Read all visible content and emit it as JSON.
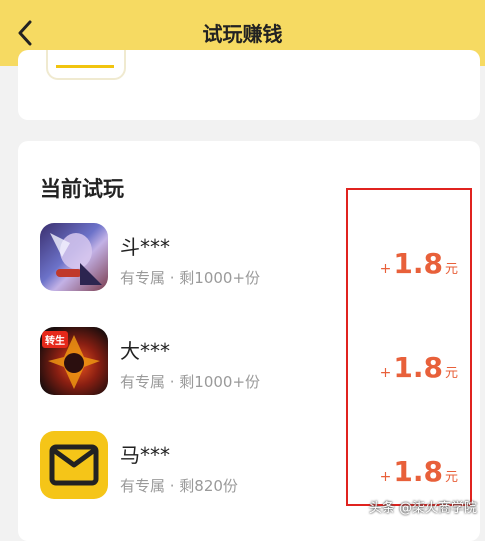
{
  "header": {
    "title": "试玩赚钱",
    "back_icon": "chevron-left-icon",
    "background": "#f6da62"
  },
  "section": {
    "title": "当前试玩"
  },
  "items": [
    {
      "name": "斗***",
      "meta": "有专属 · 剩1000+份",
      "reward_plus": "+",
      "reward_amount": "1.8",
      "reward_unit": "元",
      "icon": "game-hero-icon"
    },
    {
      "name": "大***",
      "meta": "有专属 · 剩1000+份",
      "reward_plus": "+",
      "reward_amount": "1.8",
      "reward_unit": "元",
      "icon": "game-fire-icon",
      "icon_badge": "转生"
    },
    {
      "name": "马***",
      "meta": "有专属 · 剩820份",
      "reward_plus": "+",
      "reward_amount": "1.8",
      "reward_unit": "元",
      "icon": "yellow-m-app-icon"
    }
  ],
  "watermark": "头条 @柒火商学院",
  "colors": {
    "accent": "#f6da62",
    "reward": "#e8603a",
    "highlight": "#e0231f"
  }
}
